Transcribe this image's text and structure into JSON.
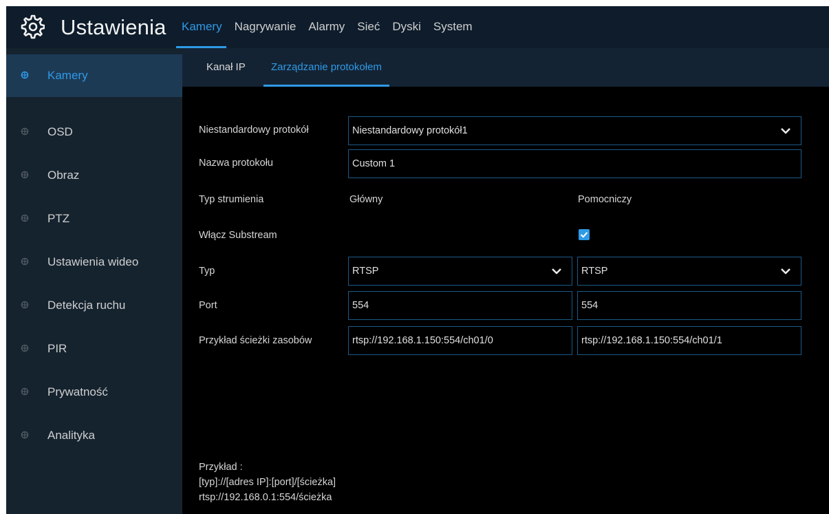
{
  "header": {
    "title": "Ustawienia",
    "icon": "settings-gear-icon",
    "tabs": [
      {
        "label": "Kamery",
        "active": true
      },
      {
        "label": "Nagrywanie",
        "active": false
      },
      {
        "label": "Alarmy",
        "active": false
      },
      {
        "label": "Sieć",
        "active": false
      },
      {
        "label": "Dyski",
        "active": false
      },
      {
        "label": "System",
        "active": false
      }
    ]
  },
  "sidebar": {
    "items": [
      {
        "label": "Kamery",
        "active": true
      },
      {
        "label": "OSD",
        "active": false
      },
      {
        "label": "Obraz",
        "active": false
      },
      {
        "label": "PTZ",
        "active": false
      },
      {
        "label": "Ustawienia wideo",
        "active": false
      },
      {
        "label": "Detekcja ruchu",
        "active": false
      },
      {
        "label": "PIR",
        "active": false
      },
      {
        "label": "Prywatność",
        "active": false
      },
      {
        "label": "Analityka",
        "active": false
      }
    ]
  },
  "subtabs": [
    {
      "label": "Kanał IP",
      "active": false
    },
    {
      "label": "Zarządzanie protokołem",
      "active": true
    }
  ],
  "form": {
    "custom_protocol": {
      "label": "Niestandardowy protokół",
      "value": "Niestandardowy protokół1"
    },
    "protocol_name": {
      "label": "Nazwa protokołu",
      "value": "Custom 1"
    },
    "stream_type": {
      "label": "Typ strumienia",
      "main": "Główny",
      "sub": "Pomocniczy"
    },
    "enable_substream": {
      "label": "Włącz Substream",
      "checked": true
    },
    "type": {
      "label": "Typ",
      "main": "RTSP",
      "sub": "RTSP"
    },
    "port": {
      "label": "Port",
      "main": "554",
      "sub": "554"
    },
    "resource_path": {
      "label": "Przykład ścieżki zasobów",
      "main": "rtsp://192.168.1.150:554/ch01/0",
      "sub": "rtsp://192.168.1.150:554/ch01/1"
    }
  },
  "example": {
    "title": "Przykład :",
    "format": "[typ]://[adres IP]:[port]/[ścieżka]",
    "sample": "rtsp://192.168.0.1:554/ścieżka"
  },
  "colors": {
    "accent": "#2f9ae6",
    "header_bg": "#0e1c2b",
    "sidebar_bg": "#15232f",
    "sidebar_active_bg": "#1d3a55",
    "field_border": "#1a5a88"
  }
}
